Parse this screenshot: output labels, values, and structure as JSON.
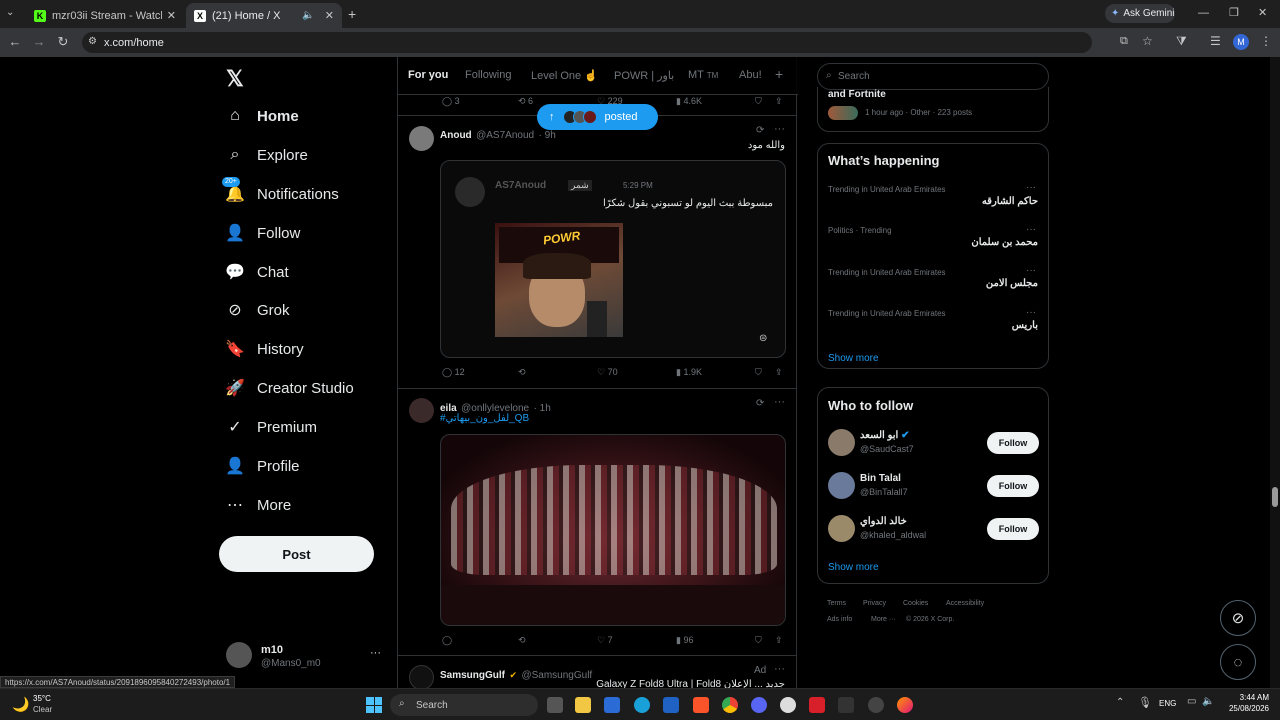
{
  "browser": {
    "tabs": [
      {
        "title": "mzr03ii Stream - Watch Live on",
        "icon": "kick-icon"
      },
      {
        "title": "(21) Home / X",
        "icon": "x-logo-icon"
      }
    ],
    "ask_gemini": "Ask Gemini",
    "url": "x.com/home",
    "profile_initial": "M",
    "status_url": "https://x.com/AS7Anoud/status/2091896095840272493/photo/1"
  },
  "sidebar": {
    "items": [
      {
        "label": "Home",
        "icon": "home-icon"
      },
      {
        "label": "Explore",
        "icon": "search-icon"
      },
      {
        "label": "Notifications",
        "icon": "bell-icon",
        "badge": "20+"
      },
      {
        "label": "Follow",
        "icon": "person-add-icon"
      },
      {
        "label": "Chat",
        "icon": "chat-icon"
      },
      {
        "label": "Grok",
        "icon": "grok-icon"
      },
      {
        "label": "History",
        "icon": "bookmark-icon"
      },
      {
        "label": "Creator Studio",
        "icon": "rocket-icon"
      },
      {
        "label": "Premium",
        "icon": "verified-icon"
      },
      {
        "label": "Profile",
        "icon": "profile-icon"
      },
      {
        "label": "More",
        "icon": "more-circle-icon"
      }
    ],
    "post_label": "Post",
    "account": {
      "name": "m10",
      "handle": "@Mans0_m0",
      "more": "···"
    }
  },
  "feed": {
    "tabs": [
      "For you",
      "Following",
      "Level One ☝",
      "POWR | باور",
      "MT",
      "Abu!"
    ],
    "tab_mt_suffix": "TM",
    "add_tab": "+",
    "prev_actions": {
      "replies": "3",
      "reposts": "6",
      "likes": "229",
      "views": "4.6K"
    },
    "posted_pill": "posted",
    "tweets": [
      {
        "name": "Anoud",
        "handle": "@AS7Anoud",
        "time": "· 9h",
        "text": "والله مود",
        "quote": {
          "name": "AS7Anoud",
          "handle": "شمر",
          "time": "5:29 PM",
          "text": "مبسوطة ببث اليوم لو تسبوني بقول شكرًا",
          "image_text": "POWR"
        },
        "actions": {
          "replies": "12",
          "reposts": "",
          "likes": "70",
          "views": "1.9K"
        }
      },
      {
        "name": "eila",
        "handle": "@onllylevelone",
        "time": "· 1h",
        "text": "#لفل_ون_بيهاتي_QB",
        "actions": {
          "replies": "",
          "reposts": "",
          "likes": "7",
          "views": "96"
        }
      },
      {
        "name": "SamsungGulf",
        "handle": "@SamsungGulf",
        "badge": "Ad",
        "text": "Galaxy Z Fold8 Ultra | Fold8 جديد ... الإعلان"
      }
    ]
  },
  "right": {
    "search_placeholder": "Search",
    "top_card": {
      "title": "and Fortnite",
      "meta": "1 hour ago · Other · 223 posts"
    },
    "whats_happening": {
      "title": "What’s happening",
      "trends": [
        {
          "meta": "Trending in United Arab Emirates",
          "name": "حاكم الشارقه"
        },
        {
          "meta": "Politics · Trending",
          "name": "محمد بن سلمان"
        },
        {
          "meta": "Trending in United Arab Emirates",
          "name": "مجلس الامن"
        },
        {
          "meta": "Trending in United Arab Emirates",
          "name": "باريس"
        }
      ],
      "show_more": "Show more"
    },
    "who_to_follow": {
      "title": "Who to follow",
      "users": [
        {
          "name": "ابو السعد",
          "handle": "@SaudCast7",
          "follow": "Follow"
        },
        {
          "name": "Bin Talal",
          "handle": "@BinTalall7",
          "follow": "Follow"
        },
        {
          "name": "خالد الدواي",
          "handle": "@khaled_aldwal",
          "follow": "Follow"
        }
      ],
      "show_more": "Show more"
    },
    "footer": [
      "Terms",
      "Privacy",
      "Cookies",
      "Accessibility",
      "Ads info",
      "More ···",
      "© 2026 X Corp."
    ]
  },
  "taskbar": {
    "weather_temp": "35°C",
    "weather_desc": "Clear",
    "search": "Search",
    "lang": "ENG",
    "time": "3:44 AM",
    "date": "25/08/2026"
  }
}
